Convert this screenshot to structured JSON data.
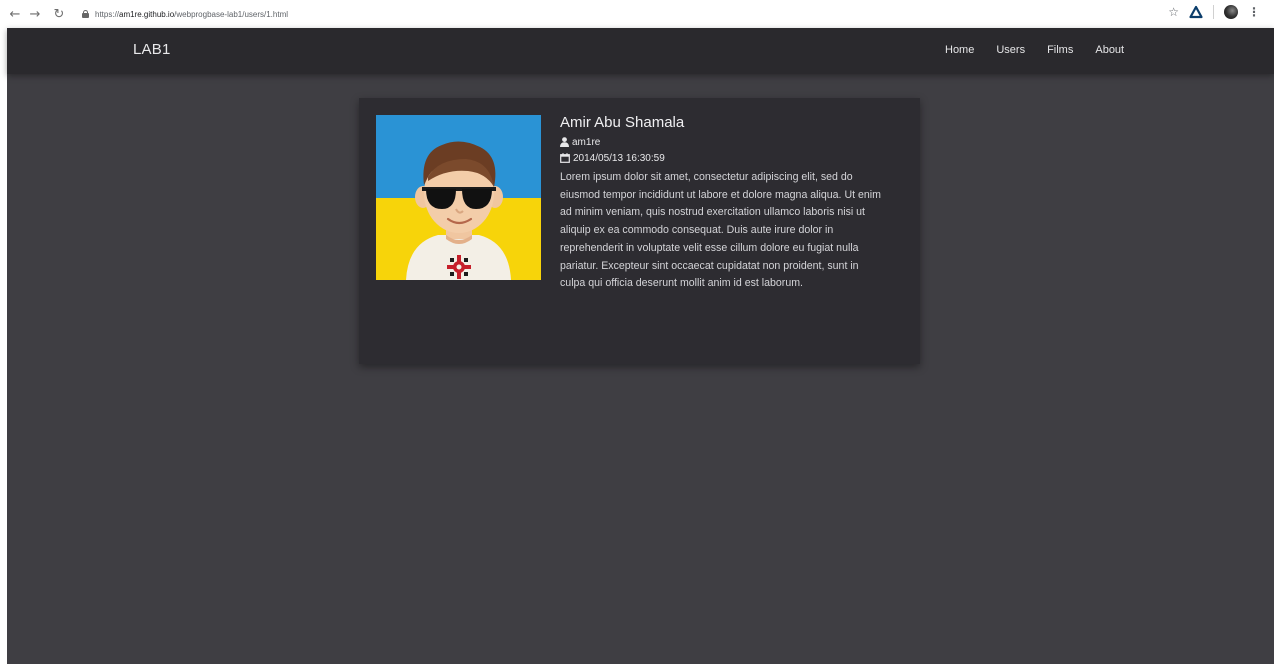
{
  "browser": {
    "url_prefix": "https://",
    "url_host": "am1re.github.io",
    "url_path": "/webprogbase-lab1/users/1.html"
  },
  "site": {
    "brand": "LAB1",
    "nav": [
      "Home",
      "Users",
      "Films",
      "About"
    ]
  },
  "user": {
    "full_name": "Amir Abu Shamala",
    "login": "am1re",
    "registered": "2014/05/13 16:30:59",
    "bio": "Lorem ipsum dolor sit amet, consectetur adipiscing elit, sed do eiusmod tempor incididunt ut labore et dolore magna aliqua. Ut enim ad minim veniam, quis nostrud exercitation ullamco laboris nisi ut aliquip ex ea commodo consequat. Duis aute irure dolor in reprehenderit in voluptate velit esse cillum dolore eu fugiat nulla pariatur. Excepteur sint occaecat cupidatat non proident, sunt in culpa qui officia deserunt mollit anim id est laborum."
  },
  "icons": {
    "back": "arrow-left-icon",
    "forward": "arrow-right-icon",
    "reload": "reload-icon",
    "lock": "lock-icon",
    "bookmark": "star-icon",
    "extension": "triangle-extension-icon",
    "profile": "profile-avatar-icon",
    "menu": "kebab-menu-icon",
    "user": "user-icon",
    "calendar": "calendar-icon"
  },
  "colors": {
    "page_bg": "#3f3e43",
    "nav_bg": "#2a292d",
    "card_bg": "#2d2c31",
    "flag_blue": "#2a93d5",
    "flag_yellow": "#f7d40a"
  }
}
